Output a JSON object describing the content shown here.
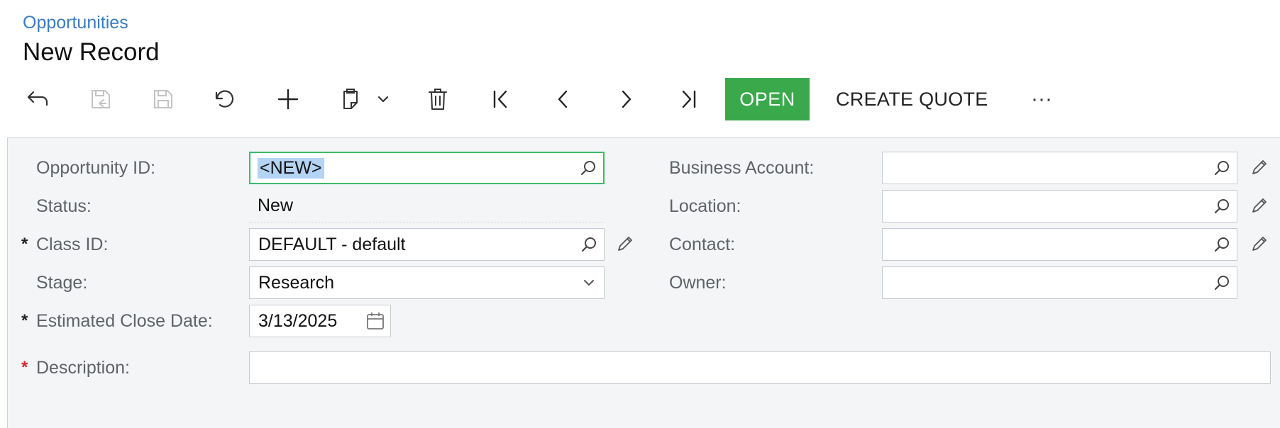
{
  "header": {
    "breadcrumb": "Opportunities",
    "title": "New Record"
  },
  "toolbar": {
    "icons": [
      "back-icon",
      "save-close-icon",
      "save-icon",
      "undo-icon",
      "add-icon",
      "copy-paste-icon",
      "chevron-down-icon",
      "delete-icon",
      "first-record-icon",
      "previous-record-icon",
      "next-record-icon",
      "last-record-icon"
    ],
    "open_label": "OPEN",
    "create_quote_label": "CREATE QUOTE",
    "more_label": "···"
  },
  "form": {
    "opportunity_id": {
      "label": "Opportunity ID:",
      "value": "<NEW>"
    },
    "status": {
      "label": "Status:",
      "value": "New"
    },
    "class_id": {
      "label": "Class ID:",
      "value": "DEFAULT - default",
      "required_mark": "*"
    },
    "stage": {
      "label": "Stage:",
      "value": "Research"
    },
    "estimated_close_date": {
      "label": "Estimated Close Date:",
      "value": "3/13/2025",
      "required_mark": "*"
    },
    "description": {
      "label": "Description:",
      "value": "",
      "required_mark": "*"
    },
    "business_account": {
      "label": "Business Account:",
      "value": ""
    },
    "location": {
      "label": "Location:",
      "value": ""
    },
    "contact": {
      "label": "Contact:",
      "value": ""
    },
    "owner": {
      "label": "Owner:",
      "value": ""
    }
  },
  "colors": {
    "link": "#3a7cc4",
    "open_button": "#39a94b",
    "focus_border": "#3dbb6b",
    "required_red": "#d0242b",
    "panel_background": "#f4f5f7"
  }
}
